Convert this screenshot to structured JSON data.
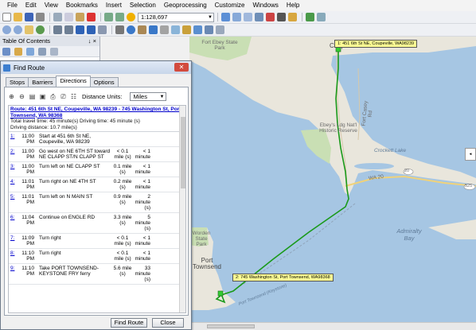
{
  "menu": [
    "File",
    "Edit",
    "View",
    "Bookmarks",
    "Insert",
    "Selection",
    "Geoprocessing",
    "Customize",
    "Windows",
    "Help"
  ],
  "toolbar": {
    "scale": "1:128,697"
  },
  "toc": {
    "title": "Table Of Contents",
    "pin": "↓ ×"
  },
  "dialog": {
    "title": "Find Route",
    "close": "✕",
    "tabs": [
      "Stops",
      "Barriers",
      "Directions",
      "Options"
    ],
    "distance_units_label": "Distance Units:",
    "distance_units_value": "Miles",
    "route_link": "Route: 451 6th St NE, Coupeville, WA 98239 - 745 Washington St, Port Townsend, WA 98368",
    "total_time": "Total travel time: 45 minute(s) Driving time: 45 minute (s)",
    "driving_distance": "Driving distance: 10.7 mile(s)",
    "steps": [
      {
        "num": "1:",
        "time": "11:00 PM",
        "text": "Start at 451 6th St NE, Coupeville, WA 98239",
        "dist": "",
        "dur": ""
      },
      {
        "num": "2:",
        "time": "11:00 PM",
        "text": "Go west on NE 6TH ST toward NE CLAPP ST/N CLAPP ST",
        "dist": "< 0.1 mile (s)",
        "dur": "< 1 minute"
      },
      {
        "num": "3:",
        "time": "11:00 PM",
        "text": "Turn left on NE CLAPP ST",
        "dist": "0.1 mile (s)",
        "dur": "< 1 minute"
      },
      {
        "num": "4:",
        "time": "11:01 PM",
        "text": "Turn right on NE 4TH ST",
        "dist": "0.2 mile (s)",
        "dur": "< 1 minute"
      },
      {
        "num": "5:",
        "time": "11:01 PM",
        "text": "Turn left on N MAIN ST",
        "dist": "0.9 mile (s)",
        "dur": "2 minute (s)"
      },
      {
        "num": "6:",
        "time": "11:04 PM",
        "text": "Continue on ENGLE RD",
        "dist": "3.3 mile (s)",
        "dur": "5 minute (s)"
      },
      {
        "num": "7:",
        "time": "11:09 PM",
        "text": "Turn right",
        "dist": "< 0.1 mile (s)",
        "dur": "< 1 minute"
      },
      {
        "num": "8:",
        "time": "11:10 PM",
        "text": "Turn right",
        "dist": "< 0.1 mile (s)",
        "dur": "< 1 minute"
      },
      {
        "num": "9:",
        "time": "11:10 PM",
        "text": "Take PORT TOWNSEND-KEYSTONE FRY ferry",
        "dist": "5.6 mile (s)",
        "dur": "33 minute (s)"
      }
    ],
    "find_route_button": "Find Route",
    "close_button": "Close"
  },
  "map": {
    "stop1_label": "1: 451 6th St NE, Coupeville, WA98239",
    "stop2_label": "2: 745 Washington St, Port Townsend, WA98368",
    "labels": {
      "fort_ebey": "Fort Ebey State Park",
      "coupeville": "Coupeville",
      "ebeys": "Ebey's Ldg Nat'l Historic Reserve",
      "fort_casey_rd": "Fort Casey Rd",
      "crockett_lake": "Crockett Lake",
      "wa20": "WA 20",
      "hw20": "20",
      "hw525": "525",
      "admiralty_bay": "Admiralty Bay",
      "worden": "Worden State Park",
      "port_townsend": "Port Townsend",
      "ferry_route": "Port Townsend (Keystone)"
    },
    "route_color": "#1a9a1a",
    "land_color": "#e9e6dc",
    "water_color": "#a6c6e3",
    "park_color": "#c9dfb4"
  }
}
